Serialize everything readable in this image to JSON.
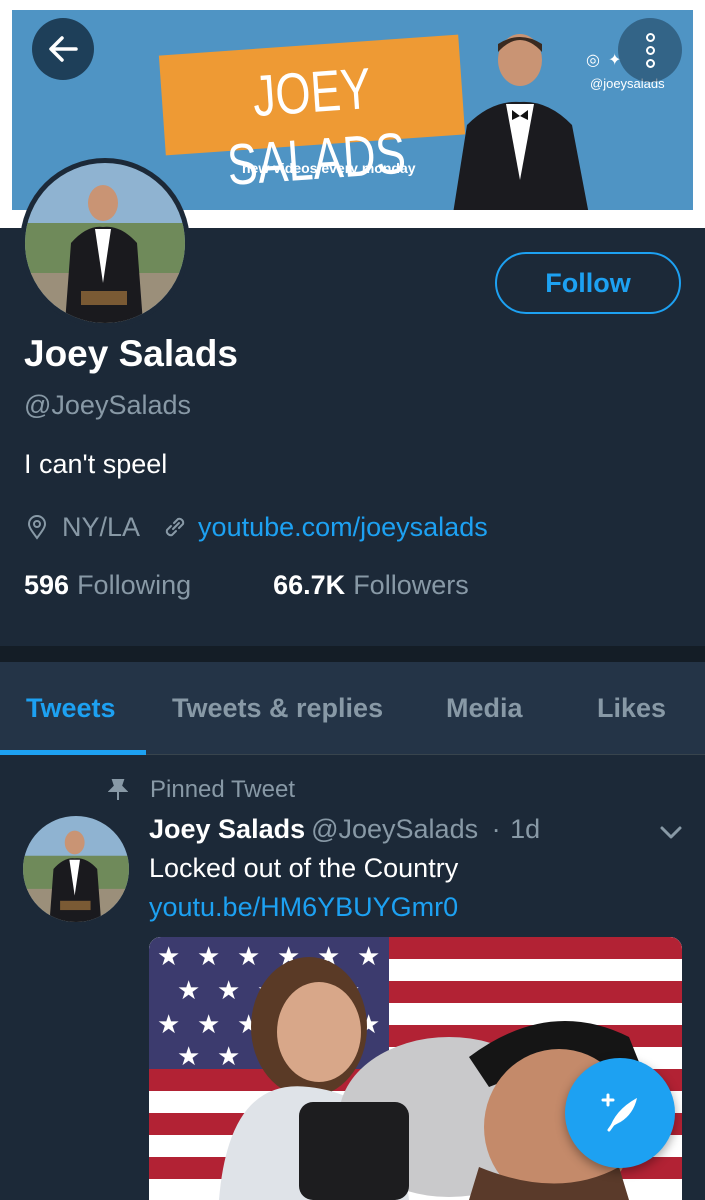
{
  "banner": {
    "logo_text": "JOEY SALADS",
    "tagline": "new videos every monday",
    "social_handle": "@joeysalads",
    "social_icons": [
      "instagram-icon",
      "twitter-icon",
      "facebook-icon"
    ]
  },
  "profile": {
    "name": "Joey Salads",
    "handle": "@JoeySalads",
    "bio": "I can't speel",
    "location": "NY/LA",
    "website": "youtube.com/joeysalads",
    "following_count": "596",
    "following_label": "Following",
    "followers_count": "66.7K",
    "followers_label": "Followers",
    "follow_label": "Follow"
  },
  "tabs": [
    {
      "label": "Tweets",
      "active": true
    },
    {
      "label": "Tweets & replies",
      "active": false
    },
    {
      "label": "Media",
      "active": false
    },
    {
      "label": "Likes",
      "active": false
    }
  ],
  "pinned_tweet": {
    "pinned_label": "Pinned Tweet",
    "author_name": "Joey Salads",
    "author_handle": "@JoeySalads",
    "separator": "·",
    "time": "1d",
    "text": "Locked out of the Country",
    "link": "youtu.be/HM6YBUYGmr0"
  },
  "colors": {
    "background": "#1c2938",
    "accent": "#1da1f2",
    "secondary_text": "#8899a6",
    "banner_blue": "#4f94c4",
    "logo_orange": "#ee9a34"
  }
}
